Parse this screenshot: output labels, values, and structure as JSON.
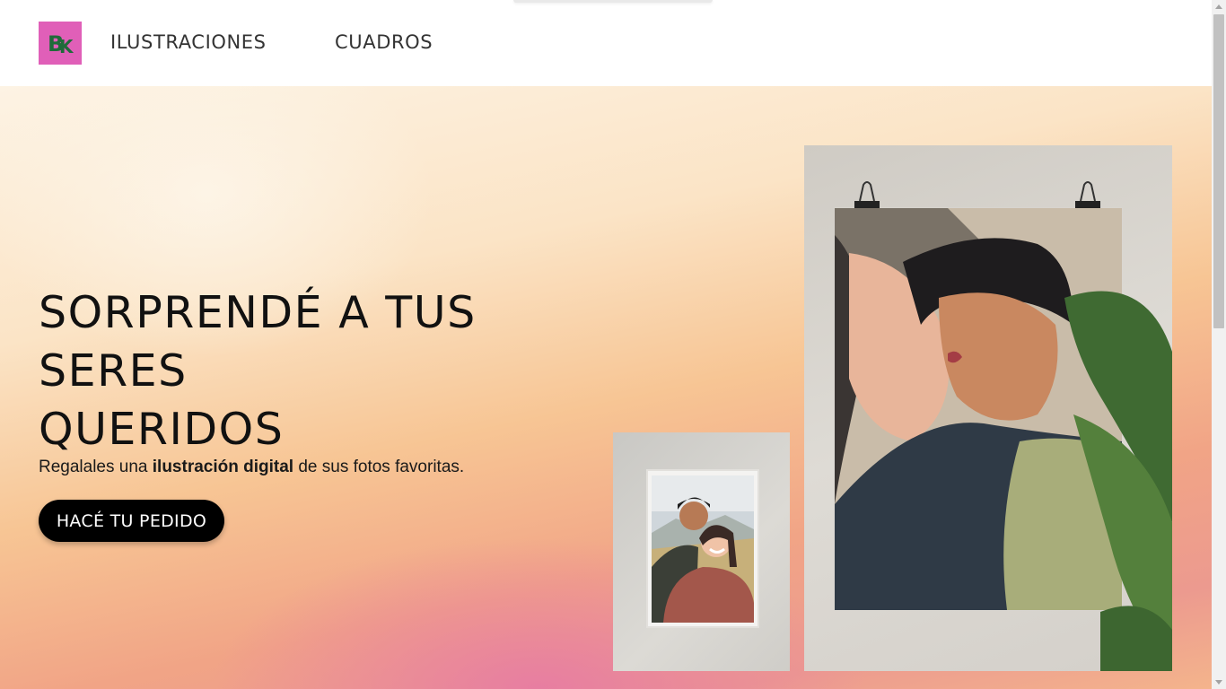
{
  "nav": {
    "logo_alt": "BK",
    "links": [
      {
        "label": "ILUSTRACIONES"
      },
      {
        "label": "CUADROS"
      }
    ]
  },
  "hero": {
    "title_lines": [
      "SORPRENDÉ A TUS",
      "SERES",
      "QUERIDOS"
    ],
    "subtitle_before": "Regalales una ",
    "subtitle_bold": "ilustración digital",
    "subtitle_after": " de sus fotos favoritas.",
    "cta_label": "HACÉ TU PEDIDO"
  },
  "images": {
    "small": "framed-couple-selfie-illustration",
    "large": "couple-kiss-poster-illustration"
  },
  "colors": {
    "logo_bg": "#e05fb8",
    "logo_fg": "#1f6b3a",
    "cta_bg": "#000000"
  }
}
